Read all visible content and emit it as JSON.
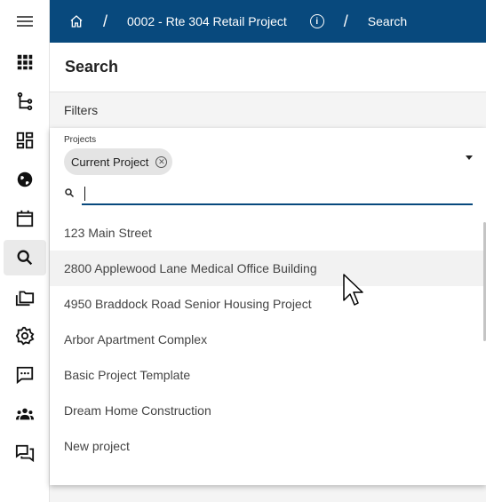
{
  "topbar": {
    "project": "0002 - Rte 304 Retail Project",
    "separator": "/",
    "page": "Search",
    "colors": {
      "bar": "#08497d"
    }
  },
  "rail": {
    "items": [
      {
        "name": "apps-icon"
      },
      {
        "name": "tree-icon"
      },
      {
        "name": "dashboard-icon"
      },
      {
        "name": "globe-icon"
      },
      {
        "name": "calendar-icon"
      },
      {
        "name": "search-icon",
        "active": true
      },
      {
        "name": "folders-icon"
      },
      {
        "name": "gear-icon"
      },
      {
        "name": "chat-icon"
      },
      {
        "name": "people-icon"
      },
      {
        "name": "forum-icon"
      }
    ]
  },
  "page": {
    "title": "Search"
  },
  "filters": {
    "title": "Filters",
    "projects_label": "Projects",
    "chip": "Current Project",
    "search_value": "",
    "options": [
      "123 Main Street",
      "2800 Applewood Lane Medical Office Building",
      "4950 Braddock Road Senior Housing Project",
      "Arbor Apartment Complex",
      "Basic Project Template",
      "Dream Home Construction",
      "New project"
    ]
  }
}
